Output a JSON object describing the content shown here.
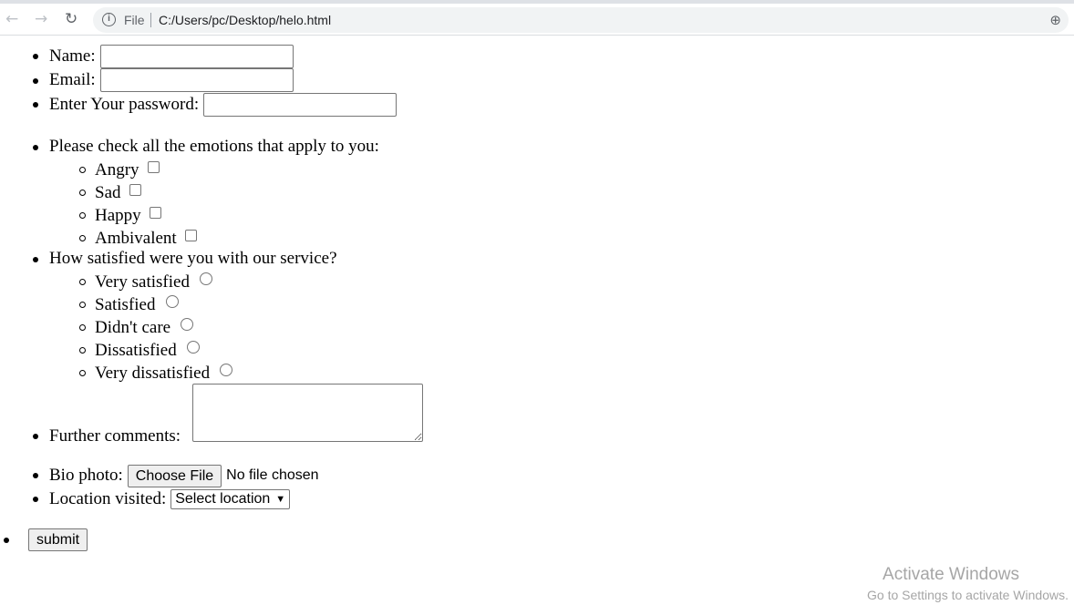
{
  "browser": {
    "file_label": "File",
    "url": "C:/Users/pc/Desktop/helo.html"
  },
  "form": {
    "name_label": "Name:",
    "email_label": "Email:",
    "password_label": "Enter Your password:",
    "emotions_label": "Please check all the emotions that apply to you:",
    "emotions": [
      "Angry",
      "Sad",
      "Happy",
      "Ambivalent"
    ],
    "satisfaction_label": "How satisfied were you with our service?",
    "satisfaction": [
      "Very satisfied",
      "Satisfied",
      "Didn't care",
      "Dissatisfied",
      "Very dissatisfied"
    ],
    "comments_label": "Further comments:",
    "bio_label": "Bio photo:",
    "choose_file": "Choose File",
    "no_file": "No file chosen",
    "location_label": "Location visited:",
    "location_selected": "Select location",
    "submit": "submit"
  },
  "watermark": {
    "line1": "Activate Windows",
    "line2": "Go to Settings to activate Windows."
  }
}
